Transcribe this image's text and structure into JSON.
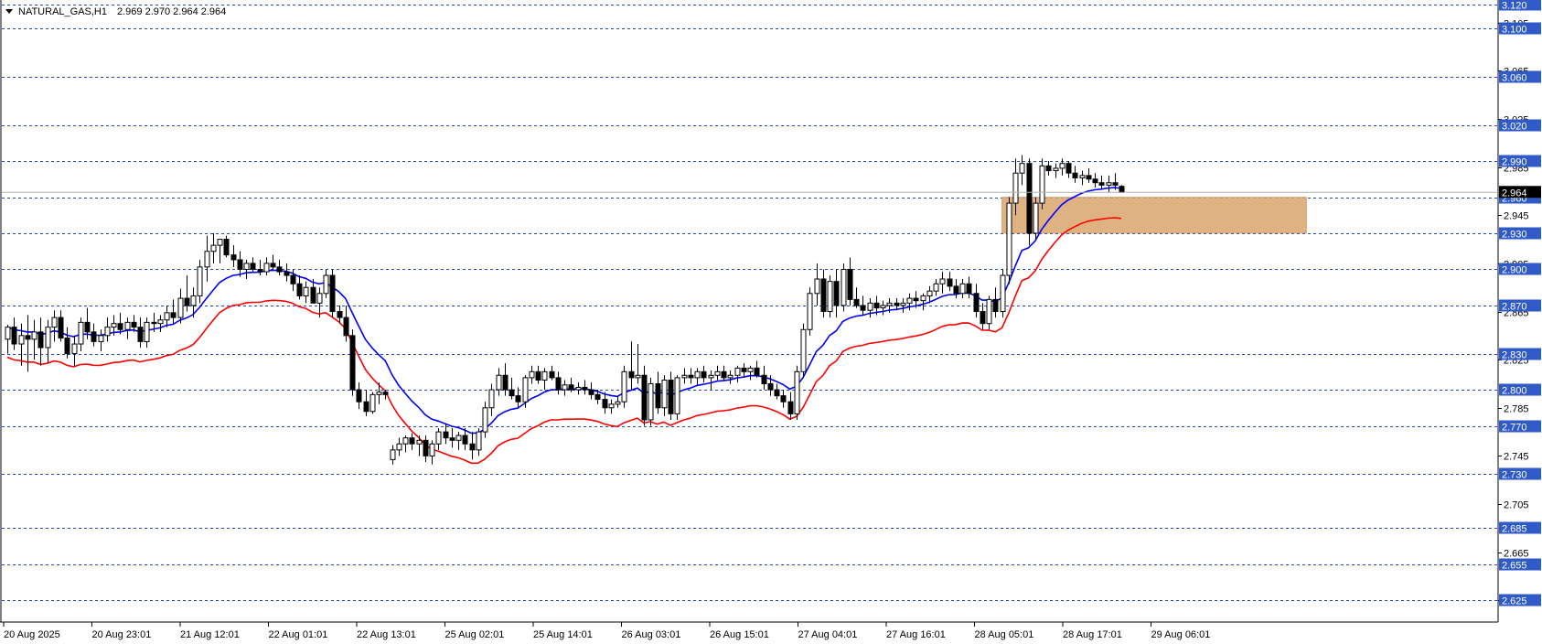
{
  "header": {
    "symbol": "NATURAL_GAS,H1",
    "ohlc": "2.969 2.970 2.964 2.964"
  },
  "colors": {
    "background": "#ffffff",
    "grid": "#1f49b8",
    "level_box": "#2f5ac8",
    "fast_ma": "#0000ff",
    "slow_ma": "#ff0000",
    "zone": "#d9a56b",
    "candle_bull": "#ffffff",
    "candle_bear": "#000000",
    "current_price_box": "#000000"
  },
  "chart_data": {
    "type": "candlestick",
    "title": "NATURAL_GAS,H1",
    "ylim": [
      2.607,
      3.12
    ],
    "y_ticks": [
      "3.105",
      "3.065",
      "3.025",
      "2.985",
      "2.945",
      "2.905",
      "2.865",
      "2.825",
      "2.785",
      "2.745",
      "2.705",
      "2.665",
      "2.625"
    ],
    "levels": [
      "3.120",
      "3.100",
      "3.060",
      "3.020",
      "2.990",
      "2.960",
      "2.930",
      "2.900",
      "2.870",
      "2.830",
      "2.800",
      "2.770",
      "2.730",
      "2.685",
      "2.655",
      "2.625"
    ],
    "current_price": "2.964",
    "x_labels": [
      "20 Aug 2025",
      "20 Aug 23:01",
      "21 Aug 12:01",
      "22 Aug 01:01",
      "22 Aug 13:01",
      "25 Aug 02:01",
      "25 Aug 14:01",
      "26 Aug 03:01",
      "26 Aug 15:01",
      "27 Aug 04:01",
      "27 Aug 16:01",
      "28 Aug 05:01",
      "28 Aug 17:01",
      "29 Aug 06:01"
    ],
    "zone": {
      "y_from": 2.93,
      "y_to": 2.96
    },
    "candles": [
      [
        2.842,
        2.854,
        2.83,
        2.852
      ],
      [
        2.852,
        2.86,
        2.833,
        2.838
      ],
      [
        2.838,
        2.855,
        2.82,
        2.845
      ],
      [
        2.845,
        2.862,
        2.815,
        2.842
      ],
      [
        2.842,
        2.858,
        2.825,
        2.848
      ],
      [
        2.848,
        2.86,
        2.82,
        2.835
      ],
      [
        2.835,
        2.858,
        2.822,
        2.852
      ],
      [
        2.852,
        2.866,
        2.84,
        2.86
      ],
      [
        2.86,
        2.866,
        2.84,
        2.843
      ],
      [
        2.843,
        2.852,
        2.826,
        2.83
      ],
      [
        2.83,
        2.845,
        2.82,
        2.838
      ],
      [
        2.838,
        2.86,
        2.832,
        2.856
      ],
      [
        2.856,
        2.868,
        2.842,
        2.848
      ],
      [
        2.848,
        2.855,
        2.836,
        2.84
      ],
      [
        2.84,
        2.85,
        2.832,
        2.845
      ],
      [
        2.845,
        2.86,
        2.84,
        2.852
      ],
      [
        2.852,
        2.862,
        2.845,
        2.855
      ],
      [
        2.855,
        2.864,
        2.846,
        2.85
      ],
      [
        2.85,
        2.86,
        2.842,
        2.856
      ],
      [
        2.856,
        2.862,
        2.848,
        2.852
      ],
      [
        2.852,
        2.86,
        2.835,
        2.84
      ],
      [
        2.84,
        2.86,
        2.835,
        2.856
      ],
      [
        2.856,
        2.864,
        2.848,
        2.855
      ],
      [
        2.855,
        2.862,
        2.848,
        2.858
      ],
      [
        2.858,
        2.87,
        2.852,
        2.864
      ],
      [
        2.864,
        2.875,
        2.855,
        2.86
      ],
      [
        2.86,
        2.884,
        2.855,
        2.876
      ],
      [
        2.876,
        2.895,
        2.865,
        2.87
      ],
      [
        2.87,
        2.885,
        2.86,
        2.878
      ],
      [
        2.878,
        2.908,
        2.872,
        2.902
      ],
      [
        2.902,
        2.928,
        2.89,
        2.915
      ],
      [
        2.915,
        2.93,
        2.905,
        2.92
      ],
      [
        2.92,
        2.925,
        2.905,
        2.925
      ],
      [
        2.925,
        2.928,
        2.91,
        2.912
      ],
      [
        2.912,
        2.92,
        2.902,
        2.908
      ],
      [
        2.908,
        2.915,
        2.894,
        2.9
      ],
      [
        2.9,
        2.908,
        2.892,
        2.905
      ],
      [
        2.905,
        2.91,
        2.898,
        2.9
      ],
      [
        2.9,
        2.908,
        2.895,
        2.898
      ],
      [
        2.898,
        2.91,
        2.895,
        2.905
      ],
      [
        2.905,
        2.912,
        2.9,
        2.902
      ],
      [
        2.902,
        2.908,
        2.895,
        2.898
      ],
      [
        2.898,
        2.905,
        2.89,
        2.895
      ],
      [
        2.895,
        2.9,
        2.882,
        2.888
      ],
      [
        2.888,
        2.895,
        2.875,
        2.878
      ],
      [
        2.878,
        2.89,
        2.872,
        2.885
      ],
      [
        2.885,
        2.892,
        2.875,
        2.872
      ],
      [
        2.872,
        2.885,
        2.86,
        2.88
      ],
      [
        2.88,
        2.9,
        2.876,
        2.895
      ],
      [
        2.895,
        2.9,
        2.86,
        2.865
      ],
      [
        2.865,
        2.87,
        2.855,
        2.86
      ],
      [
        2.86,
        2.87,
        2.84,
        2.845
      ],
      [
        2.845,
        2.85,
        2.795,
        2.8
      ],
      [
        2.8,
        2.806,
        2.784,
        2.79
      ],
      [
        2.79,
        2.8,
        2.778,
        2.782
      ],
      [
        2.782,
        2.798,
        2.78,
        2.796
      ],
      [
        2.796,
        2.806,
        2.788,
        2.798
      ],
      [
        2.798,
        2.8,
        2.792,
        2.796
      ],
      [
        2.742,
        2.754,
        2.738,
        2.75
      ],
      [
        2.75,
        2.76,
        2.745,
        2.755
      ],
      [
        2.755,
        2.762,
        2.748,
        2.76
      ],
      [
        2.76,
        2.764,
        2.75,
        2.755
      ],
      [
        2.755,
        2.762,
        2.745,
        2.758
      ],
      [
        2.758,
        2.762,
        2.74,
        2.745
      ],
      [
        2.745,
        2.758,
        2.738,
        2.755
      ],
      [
        2.755,
        2.768,
        2.75,
        2.765
      ],
      [
        2.765,
        2.772,
        2.755,
        2.76
      ],
      [
        2.76,
        2.768,
        2.752,
        2.758
      ],
      [
        2.758,
        2.765,
        2.75,
        2.762
      ],
      [
        2.762,
        2.768,
        2.75,
        2.755
      ],
      [
        2.755,
        2.765,
        2.742,
        2.75
      ],
      [
        2.75,
        2.768,
        2.745,
        2.765
      ],
      [
        2.765,
        2.79,
        2.76,
        2.785
      ],
      [
        2.785,
        2.805,
        2.778,
        2.8
      ],
      [
        2.8,
        2.818,
        2.795,
        2.812
      ],
      [
        2.812,
        2.822,
        2.795,
        2.8
      ],
      [
        2.8,
        2.81,
        2.792,
        2.795
      ],
      [
        2.795,
        2.802,
        2.785,
        2.79
      ],
      [
        2.79,
        2.812,
        2.785,
        2.81
      ],
      [
        2.81,
        2.82,
        2.805,
        2.815
      ],
      [
        2.815,
        2.82,
        2.805,
        2.808
      ],
      [
        2.808,
        2.818,
        2.8,
        2.815
      ],
      [
        2.815,
        2.82,
        2.808,
        2.81
      ],
      [
        2.81,
        2.815,
        2.796,
        2.8
      ],
      [
        2.8,
        2.808,
        2.795,
        2.804
      ],
      [
        2.804,
        2.81,
        2.798,
        2.8
      ],
      [
        2.8,
        2.806,
        2.796,
        2.802
      ],
      [
        2.802,
        2.808,
        2.796,
        2.8
      ],
      [
        2.8,
        2.806,
        2.792,
        2.796
      ],
      [
        2.796,
        2.8,
        2.788,
        2.792
      ],
      [
        2.792,
        2.798,
        2.78,
        2.785
      ],
      [
        2.785,
        2.792,
        2.78,
        2.788
      ],
      [
        2.788,
        2.795,
        2.785,
        2.79
      ],
      [
        2.79,
        2.82,
        2.785,
        2.815
      ],
      [
        2.815,
        2.84,
        2.8,
        2.81
      ],
      [
        2.81,
        2.838,
        2.805,
        2.812
      ],
      [
        2.812,
        2.82,
        2.77,
        2.775
      ],
      [
        2.775,
        2.81,
        2.77,
        2.805
      ],
      [
        2.805,
        2.815,
        2.78,
        2.785
      ],
      [
        2.785,
        2.812,
        2.778,
        2.808
      ],
      [
        2.808,
        2.815,
        2.775,
        2.78
      ],
      [
        2.78,
        2.812,
        2.775,
        2.81
      ],
      [
        2.81,
        2.818,
        2.805,
        2.812
      ],
      [
        2.812,
        2.818,
        2.805,
        2.81
      ],
      [
        2.81,
        2.818,
        2.804,
        2.815
      ],
      [
        2.815,
        2.82,
        2.806,
        2.81
      ],
      [
        2.81,
        2.816,
        2.8,
        2.812
      ],
      [
        2.812,
        2.82,
        2.808,
        2.815
      ],
      [
        2.815,
        2.82,
        2.808,
        2.81
      ],
      [
        2.81,
        2.816,
        2.805,
        2.812
      ],
      [
        2.812,
        2.82,
        2.806,
        2.818
      ],
      [
        2.818,
        2.822,
        2.81,
        2.815
      ],
      [
        2.815,
        2.82,
        2.808,
        2.818
      ],
      [
        2.818,
        2.824,
        2.81,
        2.812
      ],
      [
        2.812,
        2.82,
        2.8,
        2.805
      ],
      [
        2.805,
        2.812,
        2.795,
        2.8
      ],
      [
        2.8,
        2.805,
        2.792,
        2.795
      ],
      [
        2.795,
        2.8,
        2.785,
        2.79
      ],
      [
        2.79,
        2.798,
        2.775,
        2.78
      ],
      [
        2.78,
        2.82,
        2.775,
        2.815
      ],
      [
        2.815,
        2.855,
        2.81,
        2.85
      ],
      [
        2.85,
        2.885,
        2.845,
        2.88
      ],
      [
        2.88,
        2.905,
        2.87,
        2.892
      ],
      [
        2.892,
        2.9,
        2.86,
        2.865
      ],
      [
        2.865,
        2.895,
        2.86,
        2.89
      ],
      [
        2.89,
        2.9,
        2.86,
        2.87
      ],
      [
        2.87,
        2.905,
        2.865,
        2.9
      ],
      [
        2.9,
        2.91,
        2.87,
        2.875
      ],
      [
        2.875,
        2.885,
        2.868,
        2.87
      ],
      [
        2.87,
        2.878,
        2.862,
        2.866
      ],
      [
        2.866,
        2.876,
        2.86,
        2.872
      ],
      [
        2.872,
        2.878,
        2.862,
        2.868
      ],
      [
        2.868,
        2.874,
        2.862,
        2.87
      ],
      [
        2.87,
        2.876,
        2.864,
        2.872
      ],
      [
        2.872,
        2.876,
        2.866,
        2.87
      ],
      [
        2.87,
        2.876,
        2.864,
        2.872
      ],
      [
        2.872,
        2.88,
        2.866,
        2.876
      ],
      [
        2.876,
        2.882,
        2.868,
        2.874
      ],
      [
        2.874,
        2.88,
        2.866,
        2.878
      ],
      [
        2.878,
        2.886,
        2.872,
        2.882
      ],
      [
        2.882,
        2.892,
        2.878,
        2.888
      ],
      [
        2.888,
        2.898,
        2.88,
        2.892
      ],
      [
        2.892,
        2.898,
        2.882,
        2.886
      ],
      [
        2.886,
        2.892,
        2.876,
        2.88
      ],
      [
        2.88,
        2.892,
        2.876,
        2.888
      ],
      [
        2.888,
        2.894,
        2.876,
        2.88
      ],
      [
        2.88,
        2.888,
        2.86,
        2.865
      ],
      [
        2.865,
        2.872,
        2.85,
        2.855
      ],
      [
        2.855,
        2.878,
        2.85,
        2.875
      ],
      [
        2.875,
        2.885,
        2.86,
        2.865
      ],
      [
        2.865,
        2.9,
        2.86,
        2.895
      ],
      [
        2.895,
        2.96,
        2.888,
        2.955
      ],
      [
        2.955,
        2.992,
        2.945,
        2.98
      ],
      [
        2.98,
        2.995,
        2.97,
        2.988
      ],
      [
        2.988,
        2.992,
        2.92,
        2.93
      ],
      [
        2.93,
        2.96,
        2.925,
        2.955
      ],
      [
        2.955,
        2.992,
        2.95,
        2.986
      ],
      [
        2.986,
        2.99,
        2.978,
        2.982
      ],
      [
        2.982,
        2.988,
        2.976,
        2.984
      ],
      [
        2.984,
        2.992,
        2.978,
        2.988
      ],
      [
        2.988,
        2.99,
        2.976,
        2.98
      ],
      [
        2.98,
        2.986,
        2.972,
        2.976
      ],
      [
        2.976,
        2.982,
        2.97,
        2.978
      ],
      [
        2.978,
        2.984,
        2.972,
        2.975
      ],
      [
        2.975,
        2.98,
        2.968,
        2.972
      ],
      [
        2.972,
        2.978,
        2.966,
        2.97
      ],
      [
        2.97,
        2.978,
        2.964,
        2.972
      ],
      [
        2.972,
        2.98,
        2.966,
        2.97
      ],
      [
        2.969,
        2.97,
        2.964,
        2.964
      ]
    ]
  }
}
